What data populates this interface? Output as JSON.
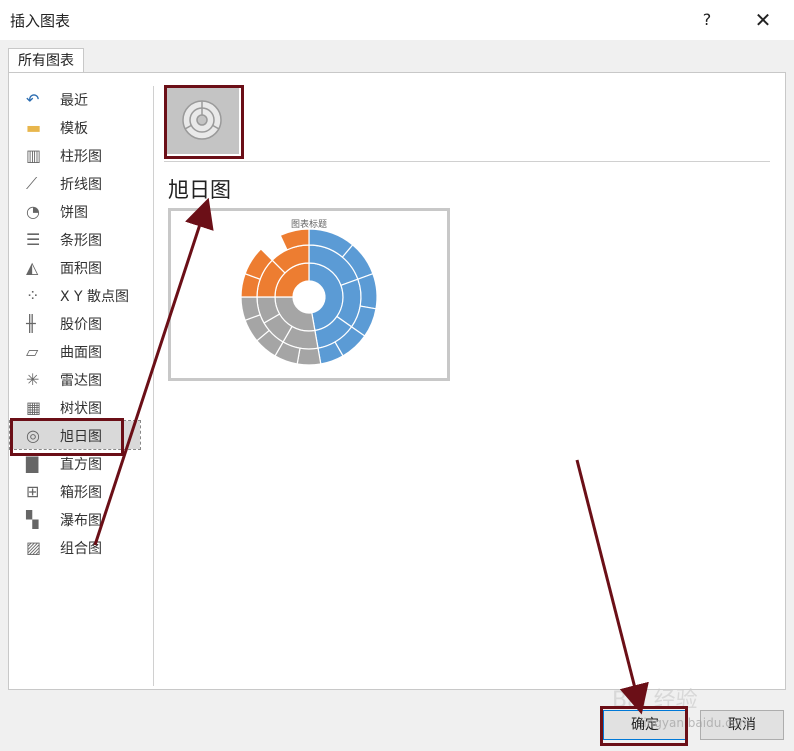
{
  "window": {
    "title": "插入图表",
    "help_label": "?",
    "close_label": "✕"
  },
  "tabs": [
    {
      "label": "所有图表"
    }
  ],
  "sidebar": {
    "items": [
      {
        "label": "最近",
        "icon": "undo-icon"
      },
      {
        "label": "模板",
        "icon": "folder-icon"
      },
      {
        "label": "柱形图",
        "icon": "column-chart-icon"
      },
      {
        "label": "折线图",
        "icon": "line-chart-icon"
      },
      {
        "label": "饼图",
        "icon": "pie-chart-icon"
      },
      {
        "label": "条形图",
        "icon": "bar-chart-icon"
      },
      {
        "label": "面积图",
        "icon": "area-chart-icon"
      },
      {
        "label": "X Y 散点图",
        "icon": "scatter-chart-icon"
      },
      {
        "label": "股价图",
        "icon": "stock-chart-icon"
      },
      {
        "label": "曲面图",
        "icon": "surface-chart-icon"
      },
      {
        "label": "雷达图",
        "icon": "radar-chart-icon"
      },
      {
        "label": "树状图",
        "icon": "treemap-chart-icon"
      },
      {
        "label": "旭日图",
        "icon": "sunburst-chart-icon",
        "selected": true
      },
      {
        "label": "直方图",
        "icon": "histogram-chart-icon"
      },
      {
        "label": "箱形图",
        "icon": "box-whisker-chart-icon"
      },
      {
        "label": "瀑布图",
        "icon": "waterfall-chart-icon"
      },
      {
        "label": "组合图",
        "icon": "combo-chart-icon"
      }
    ]
  },
  "main": {
    "chart_type_name": "旭日图",
    "preview_title": "图表标题"
  },
  "buttons": {
    "ok_label": "确定",
    "cancel_label": "取消"
  },
  "colors": {
    "accent": "#0078d7",
    "annotation": "#6b0f17",
    "blue": "#5b9bd5",
    "orange": "#ed7d31",
    "gray": "#a5a5a5"
  },
  "watermark": {
    "brand": "Bai 经验",
    "url": "jingyan.baidu.com"
  }
}
